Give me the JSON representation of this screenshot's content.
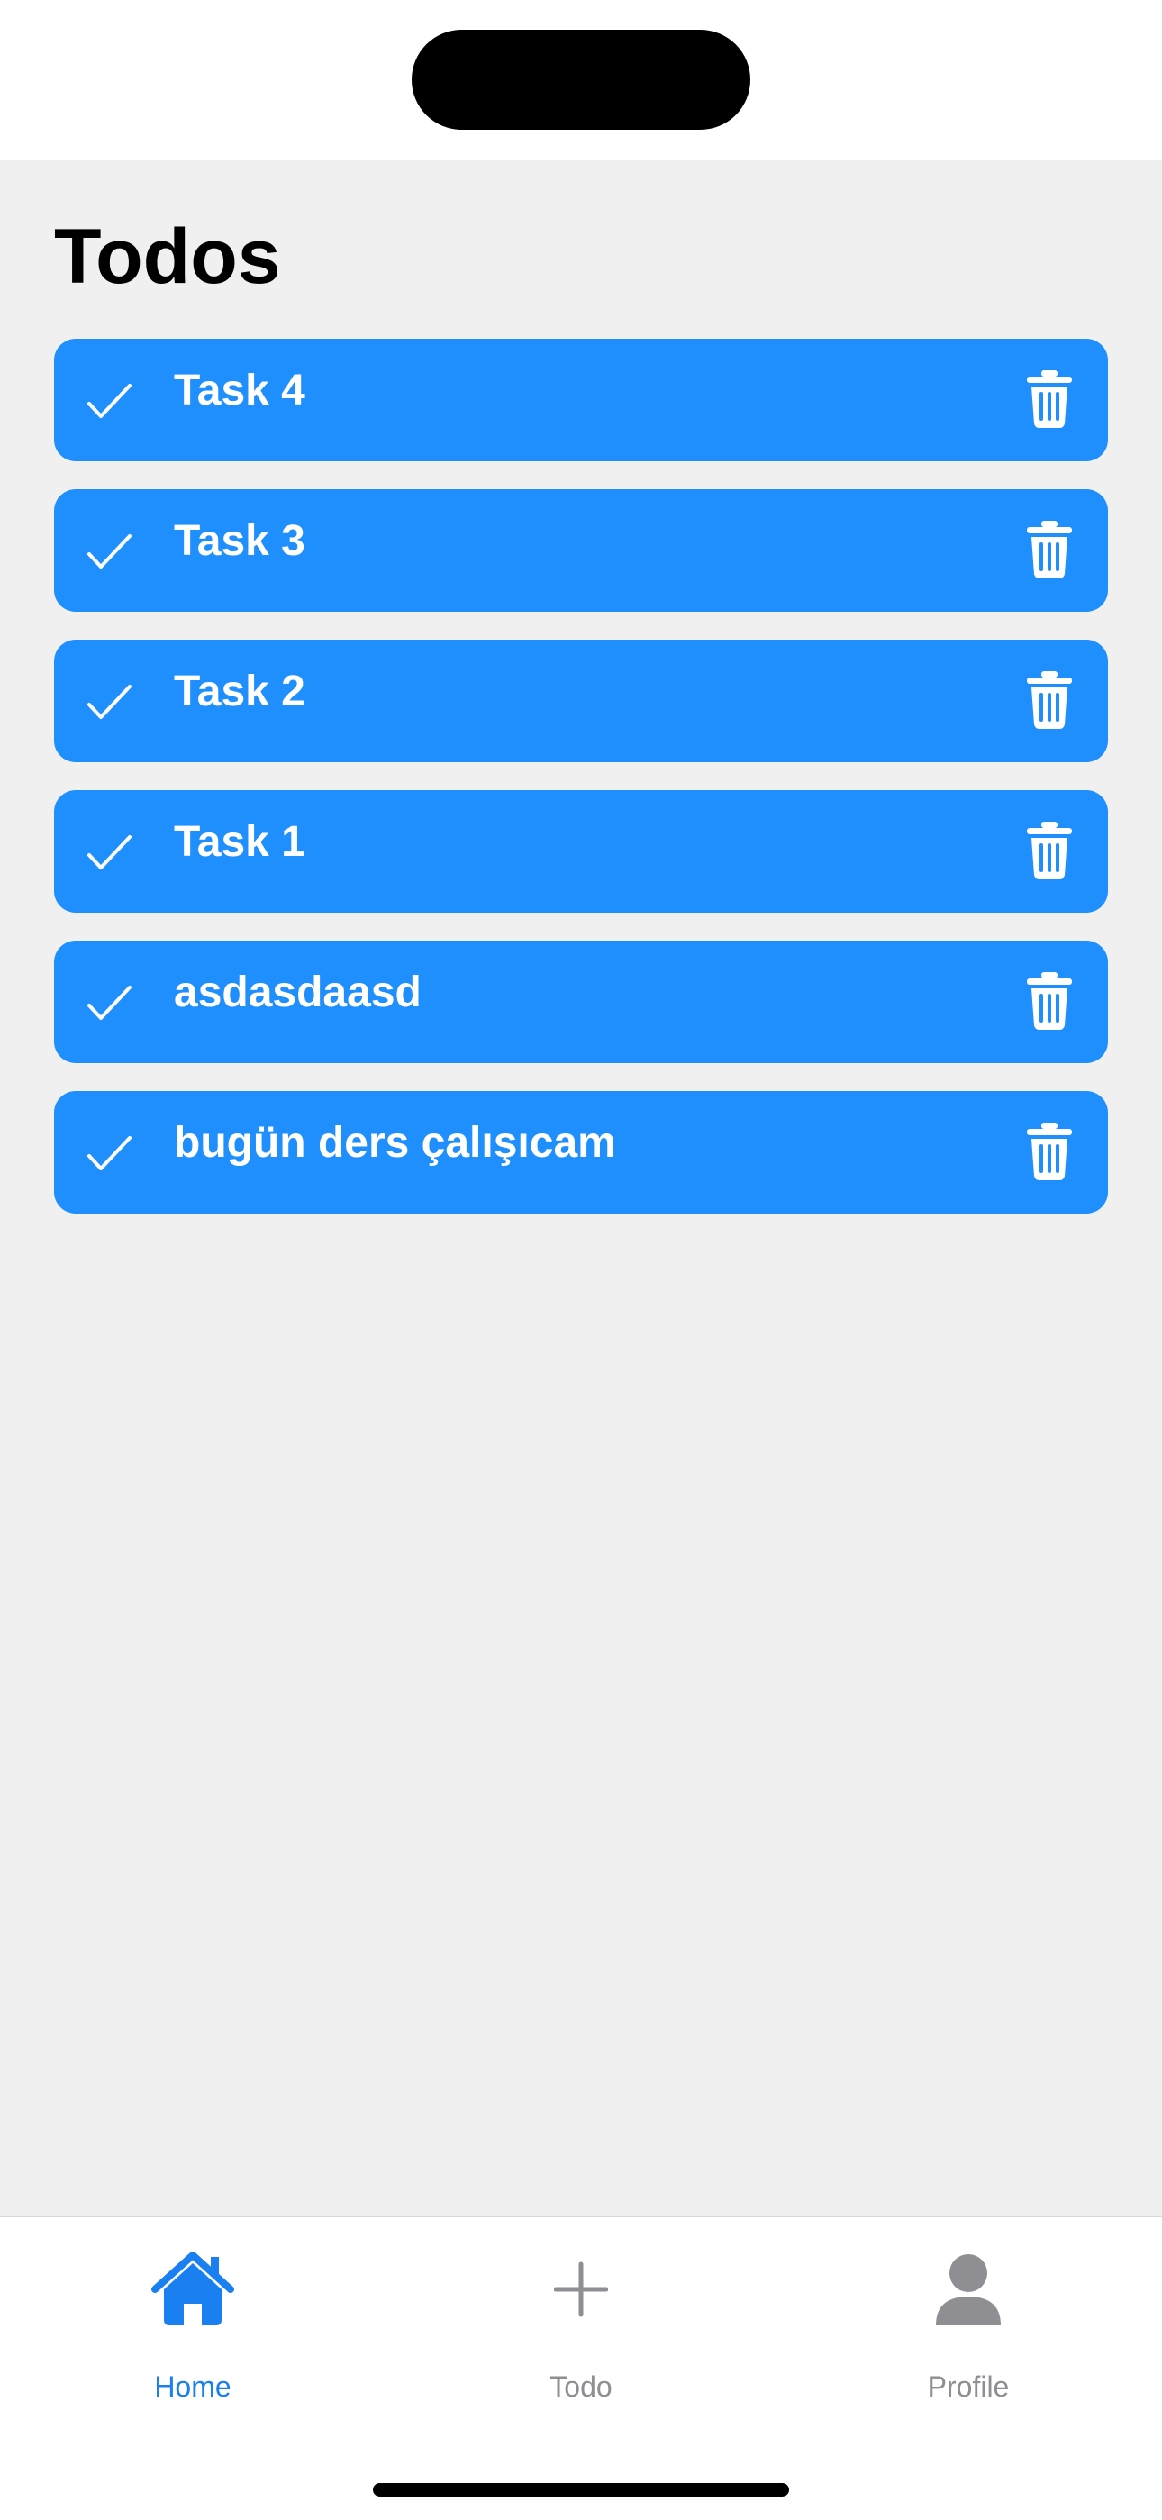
{
  "page": {
    "title": "Todos"
  },
  "todos": [
    {
      "title": "Task 4",
      "completed_icon": "checkmark-icon",
      "delete_icon": "trash-icon"
    },
    {
      "title": "Task 3",
      "completed_icon": "checkmark-icon",
      "delete_icon": "trash-icon"
    },
    {
      "title": "Task 2",
      "completed_icon": "checkmark-icon",
      "delete_icon": "trash-icon"
    },
    {
      "title": "Task 1",
      "completed_icon": "checkmark-icon",
      "delete_icon": "trash-icon"
    },
    {
      "title": "asdasdaasd",
      "completed_icon": "checkmark-icon",
      "delete_icon": "trash-icon"
    },
    {
      "title": "bugün ders çalışıcam",
      "completed_icon": "checkmark-icon",
      "delete_icon": "trash-icon"
    }
  ],
  "tab_bar": {
    "items": [
      {
        "label": "Home",
        "icon": "house-icon",
        "selected": true
      },
      {
        "label": "Todo",
        "icon": "plus-icon",
        "selected": false
      },
      {
        "label": "Profile",
        "icon": "person-icon",
        "selected": false
      }
    ]
  },
  "colors": {
    "accent": "#1f8ffd",
    "tab_selected": "#1a7ff0",
    "tab_unselected": "#8e8e93",
    "background": "#f0f0f1",
    "text_primary": "#000000"
  }
}
